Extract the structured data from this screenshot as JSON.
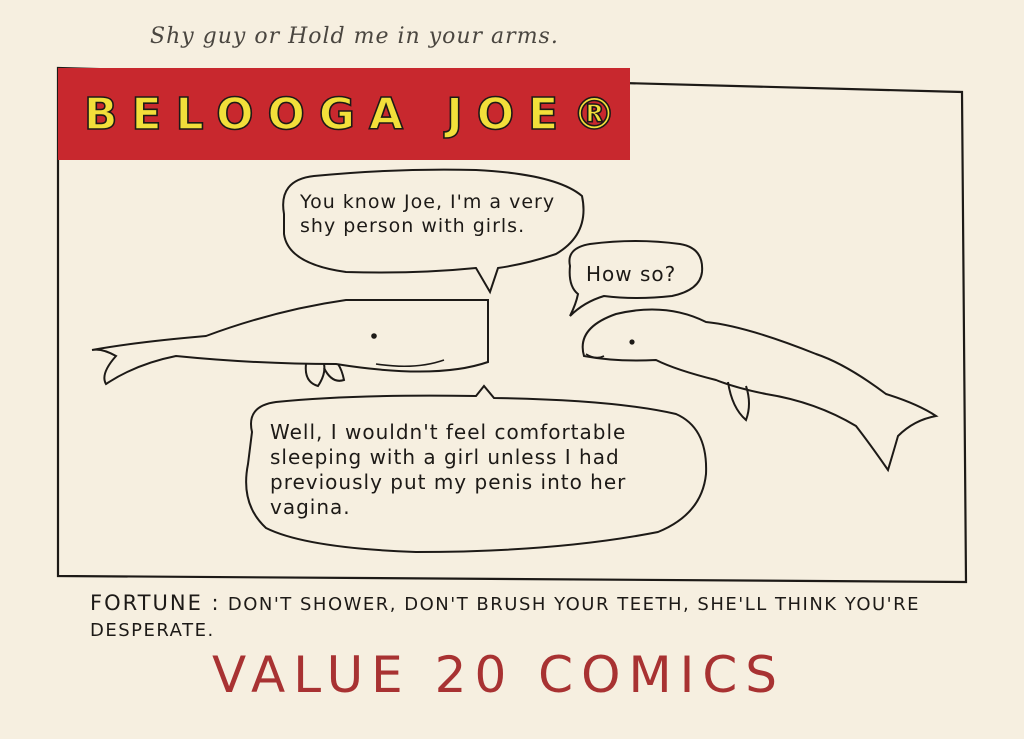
{
  "subtitle": "Shy guy or Hold me in your arms.",
  "title": "BELOOGA JOE®",
  "dialogue": {
    "sperm_whale_1": "You know Joe, I'm a very shy person with girls.",
    "beluga": "How so?",
    "sperm_whale_2": "Well, I wouldn't feel comfortable sleeping with a girl unless I had previously put my penis into her vagina."
  },
  "fortune": {
    "label": "FORTUNE :",
    "text": "DON'T SHOWER, DON'T BRUSH YOUR TEETH, SHE'LL THINK YOU'RE DESPERATE."
  },
  "value": "VALUE 20 COMICS",
  "colors": {
    "paper": "#f6efe0",
    "banner_red": "#c8282e",
    "title_yellow": "#f2df3a",
    "value_red": "#a83232",
    "ink": "#1d1a17"
  }
}
